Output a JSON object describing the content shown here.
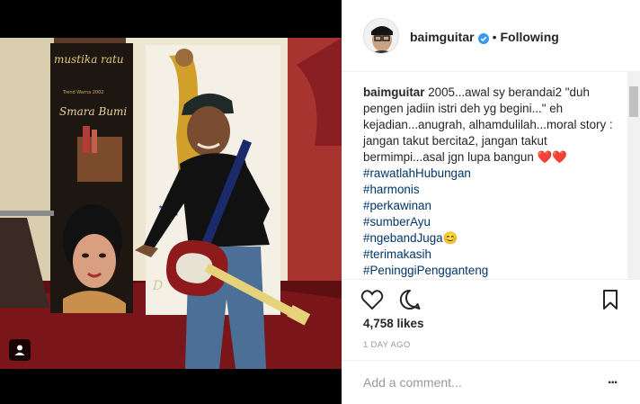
{
  "post": {
    "username": "baimguitar",
    "separator": "•",
    "follow_status": "Following",
    "caption_text": "2005...awal sy berandai2 \"duh pengen jadiin istri deh yg begini...\" eh kejadian...anugrah, alhamdulilah...moral story : jangan takut bercita2, jangan takut bermimpi...asal jgn lupa bangun ❤️❤️",
    "hashtags": [
      "#rawatlahHubungan",
      "#harmonis",
      "#perkawinan",
      "#sumberAyu",
      "#ngebandJuga😊",
      "#terimakasih",
      "#PeninggiPengganteng"
    ],
    "likes": "4,758 likes",
    "timestamp": "1 DAY AGO",
    "comment_placeholder": "Add a comment...",
    "more_label": "..."
  },
  "photo": {
    "banner_brand": "mustika ratu",
    "banner_tagline": "Trend Warna 2002",
    "banner_title": "Smara Bumi"
  },
  "icons": {
    "verified": "verified-badge-icon",
    "like": "heart-icon",
    "comment": "comment-bubble-icon",
    "save": "bookmark-icon",
    "tag": "user-tag-icon",
    "more": "more-options-icon"
  },
  "colors": {
    "hashtag": "#003569",
    "verified": "#3897f0",
    "text": "#262626",
    "muted": "#999999"
  }
}
